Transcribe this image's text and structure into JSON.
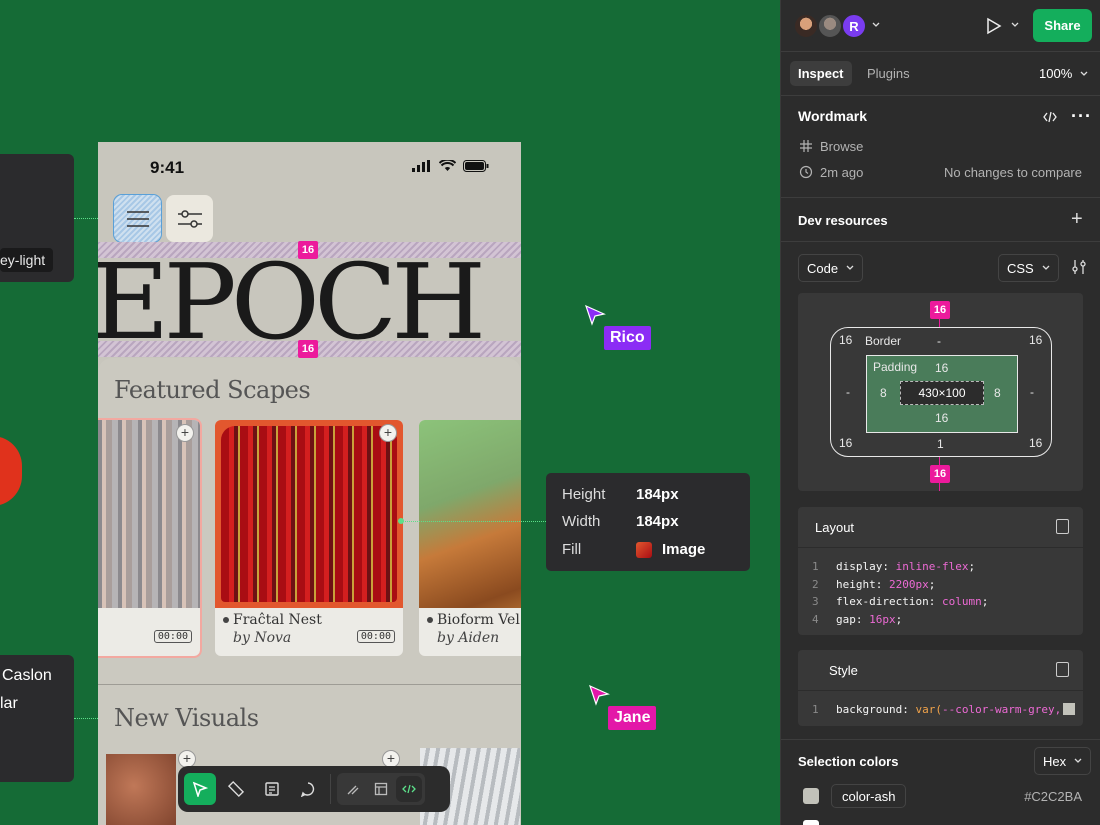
{
  "canvas": {
    "left_chip_top": "ey-light",
    "left_chip_bottom_line1": "Caslon",
    "left_chip_bottom_line2": "lar",
    "spacing_badge": "16"
  },
  "phone": {
    "time": "9:41",
    "wordmark": "EPOCH",
    "section1_title": "Featured Scapes",
    "section2_title": "New Visuals",
    "cards": [
      {
        "title": "",
        "author": "",
        "duration": "00:00"
      },
      {
        "title": "Fraĉtal Nest",
        "author": "by Nova",
        "duration": "00:00"
      },
      {
        "title": "Bioform Vel",
        "author": "by Aiden",
        "duration": ""
      }
    ]
  },
  "cursors": [
    {
      "name": "Rico",
      "color": "#8b2cf5"
    },
    {
      "name": "Jane",
      "color": "#e317a8"
    }
  ],
  "measure": {
    "height_label": "Height",
    "height_value": "184px",
    "width_label": "Width",
    "width_value": "184px",
    "fill_label": "Fill",
    "fill_value": "Image"
  },
  "panel": {
    "avatar_initial": "R",
    "share_label": "Share",
    "tabs": [
      "Inspect",
      "Plugins"
    ],
    "zoom": "100%",
    "layer_name": "Wordmark",
    "component_label": "Browse",
    "edited_time": "2m ago",
    "compare_text": "No changes to compare",
    "dev_resources": "Dev resources",
    "code_select": "Code",
    "lang_select": "CSS",
    "box_model": {
      "margin_top": "16",
      "margin_bottom": "16",
      "border_label": "Border",
      "border_top": "-",
      "border_tl": "16",
      "border_tr": "16",
      "border_bl": "16",
      "border_br": "16",
      "border_left": "-",
      "border_right": "-",
      "border_bottom": "1",
      "padding_label": "Padding",
      "padding_top": "16",
      "padding_bottom": "16",
      "padding_left": "8",
      "padding_right": "8",
      "content": "430×100"
    },
    "layout_title": "Layout",
    "layout_code": [
      {
        "n": "1",
        "prop": "display: ",
        "value": "inline-flex",
        "end": ";"
      },
      {
        "n": "2",
        "prop": "height: ",
        "value": "2200px",
        "end": ";"
      },
      {
        "n": "3",
        "prop": "flex-direction: ",
        "value": "column",
        "end": ";"
      },
      {
        "n": "4",
        "prop": "gap: ",
        "value": "16px",
        "end": ";"
      }
    ],
    "style_title": "Style",
    "style_code": {
      "n": "1",
      "prop": "background: ",
      "fn": "var(",
      "value": "--color-warm-grey,"
    },
    "selection_colors": "Selection colors",
    "color_format": "Hex",
    "colors": [
      {
        "name": "color-ash",
        "hex": "#C2C2BA"
      }
    ]
  }
}
